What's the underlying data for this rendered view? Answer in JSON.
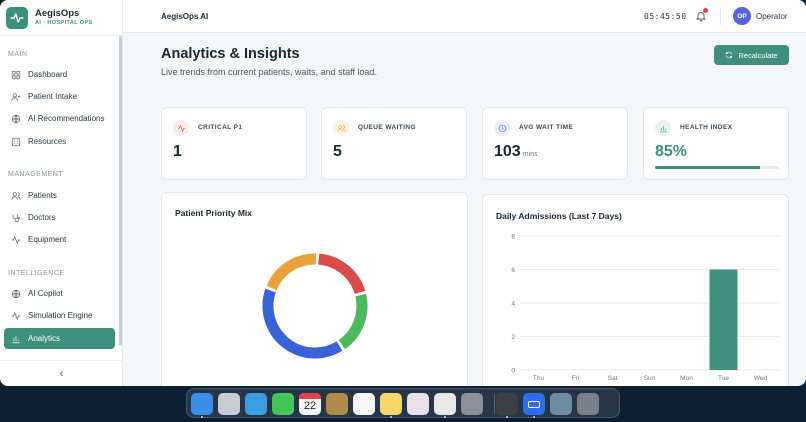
{
  "brand": {
    "name": "AegisOps",
    "subtitle": "AI · HOSPITAL OPS"
  },
  "sidebar": {
    "sections": [
      {
        "label": "MAIN"
      },
      {
        "label": "MANAGEMENT"
      },
      {
        "label": "INTELLIGENCE"
      }
    ],
    "items": [
      {
        "label": "Dashboard",
        "icon": "grid-icon"
      },
      {
        "label": "Patient Intake",
        "icon": "user-plus-icon"
      },
      {
        "label": "AI Recommendations",
        "icon": "globe-icon"
      },
      {
        "label": "Resources",
        "icon": "building-icon"
      },
      {
        "label": "Patients",
        "icon": "users-icon"
      },
      {
        "label": "Doctors",
        "icon": "stethoscope-icon"
      },
      {
        "label": "Equipment",
        "icon": "activity-icon"
      },
      {
        "label": "AI Copilot",
        "icon": "globe-icon"
      },
      {
        "label": "Simulation Engine",
        "icon": "activity-icon"
      },
      {
        "label": "Analytics",
        "icon": "bar-chart-icon",
        "active": true
      }
    ],
    "collapse_glyph": "‹"
  },
  "topbar": {
    "title": "AegisOps AI",
    "clock": "05:45:50",
    "avatar_initials": "OP",
    "user": "Operator"
  },
  "header": {
    "title": "Analytics & Insights",
    "subtitle": "Live trends from current patients, waits, and staff load.",
    "recalc_label": "Recalculate"
  },
  "kpis": [
    {
      "label": "CRITICAL P1",
      "value": "1",
      "unit": "",
      "icon": "pulse-icon",
      "color": "#e0434b",
      "bg": "#fdecec"
    },
    {
      "label": "QUEUE WAITING",
      "value": "5",
      "unit": "",
      "icon": "users-icon",
      "color": "#e09a2a",
      "bg": "#fdf3e1"
    },
    {
      "label": "AVG WAIT TIME",
      "value": "103",
      "unit": "mins",
      "icon": "clock-icon",
      "color": "#4a6fd8",
      "bg": "#e8eefb"
    },
    {
      "label": "HEALTH INDEX",
      "value": "85%",
      "unit": "",
      "icon": "bar-chart-icon",
      "color": "#3f8f7f",
      "bg": "#e6f2ef",
      "progress": 0.85
    }
  ],
  "priority_card": {
    "title": "Patient Priority Mix"
  },
  "admissions_card": {
    "title": "Daily Admissions (Last 7 Days)"
  },
  "chart_data": [
    {
      "type": "pie",
      "title": "Patient Priority Mix",
      "donut": true,
      "slices": [
        {
          "value": 1,
          "color": "#d94a4a"
        },
        {
          "value": 1,
          "color": "#4cb85c"
        },
        {
          "value": 2,
          "color": "#3a63d6"
        },
        {
          "value": 1,
          "color": "#e8a23a"
        }
      ]
    },
    {
      "type": "bar",
      "title": "Daily Admissions (Last 7 Days)",
      "categories": [
        "Thu",
        "Fri",
        "Sat",
        "Sun",
        "Mon",
        "Tue",
        "Wed"
      ],
      "values": [
        0,
        0,
        0,
        0,
        0,
        6,
        0
      ],
      "yticks": [
        "8",
        "6",
        "4",
        "2",
        "0"
      ],
      "ylim": [
        0,
        8
      ],
      "grid": true,
      "bar_color": "#3f8f7f"
    }
  ],
  "dock": {
    "calendar_day": "22",
    "apps": [
      {
        "name": "finder-icon",
        "color": "#3b8ee8",
        "running": true
      },
      {
        "name": "launchpad-icon",
        "color": "#c8cbd2",
        "running": false
      },
      {
        "name": "safari-icon",
        "color": "#3a9fe0",
        "running": false
      },
      {
        "name": "messages-icon",
        "color": "#43c55a",
        "running": false
      },
      {
        "name": "calendar-icon",
        "color": "#f4f4f4",
        "running": false
      },
      {
        "name": "keynote-icon",
        "color": "#b08a4a",
        "running": false
      },
      {
        "name": "reminders-icon",
        "color": "#f7f7f7",
        "running": false
      },
      {
        "name": "notes-icon",
        "color": "#f5d66a",
        "running": true
      },
      {
        "name": "photos-icon",
        "color": "#e8e1e8",
        "running": false
      },
      {
        "name": "chrome-icon",
        "color": "#e8e8e8",
        "running": true
      },
      {
        "name": "settings-icon",
        "color": "#8c9099",
        "running": false
      },
      {
        "name": "package-icon",
        "color": "#3c3f44",
        "running": true
      },
      {
        "name": "zoom-icon",
        "color": "#2d6bf0",
        "running": true
      },
      {
        "name": "quicktime-icon",
        "color": "#6f8aa3",
        "running": false
      },
      {
        "name": "trash-icon",
        "color": "#7b8088",
        "running": false
      }
    ]
  }
}
